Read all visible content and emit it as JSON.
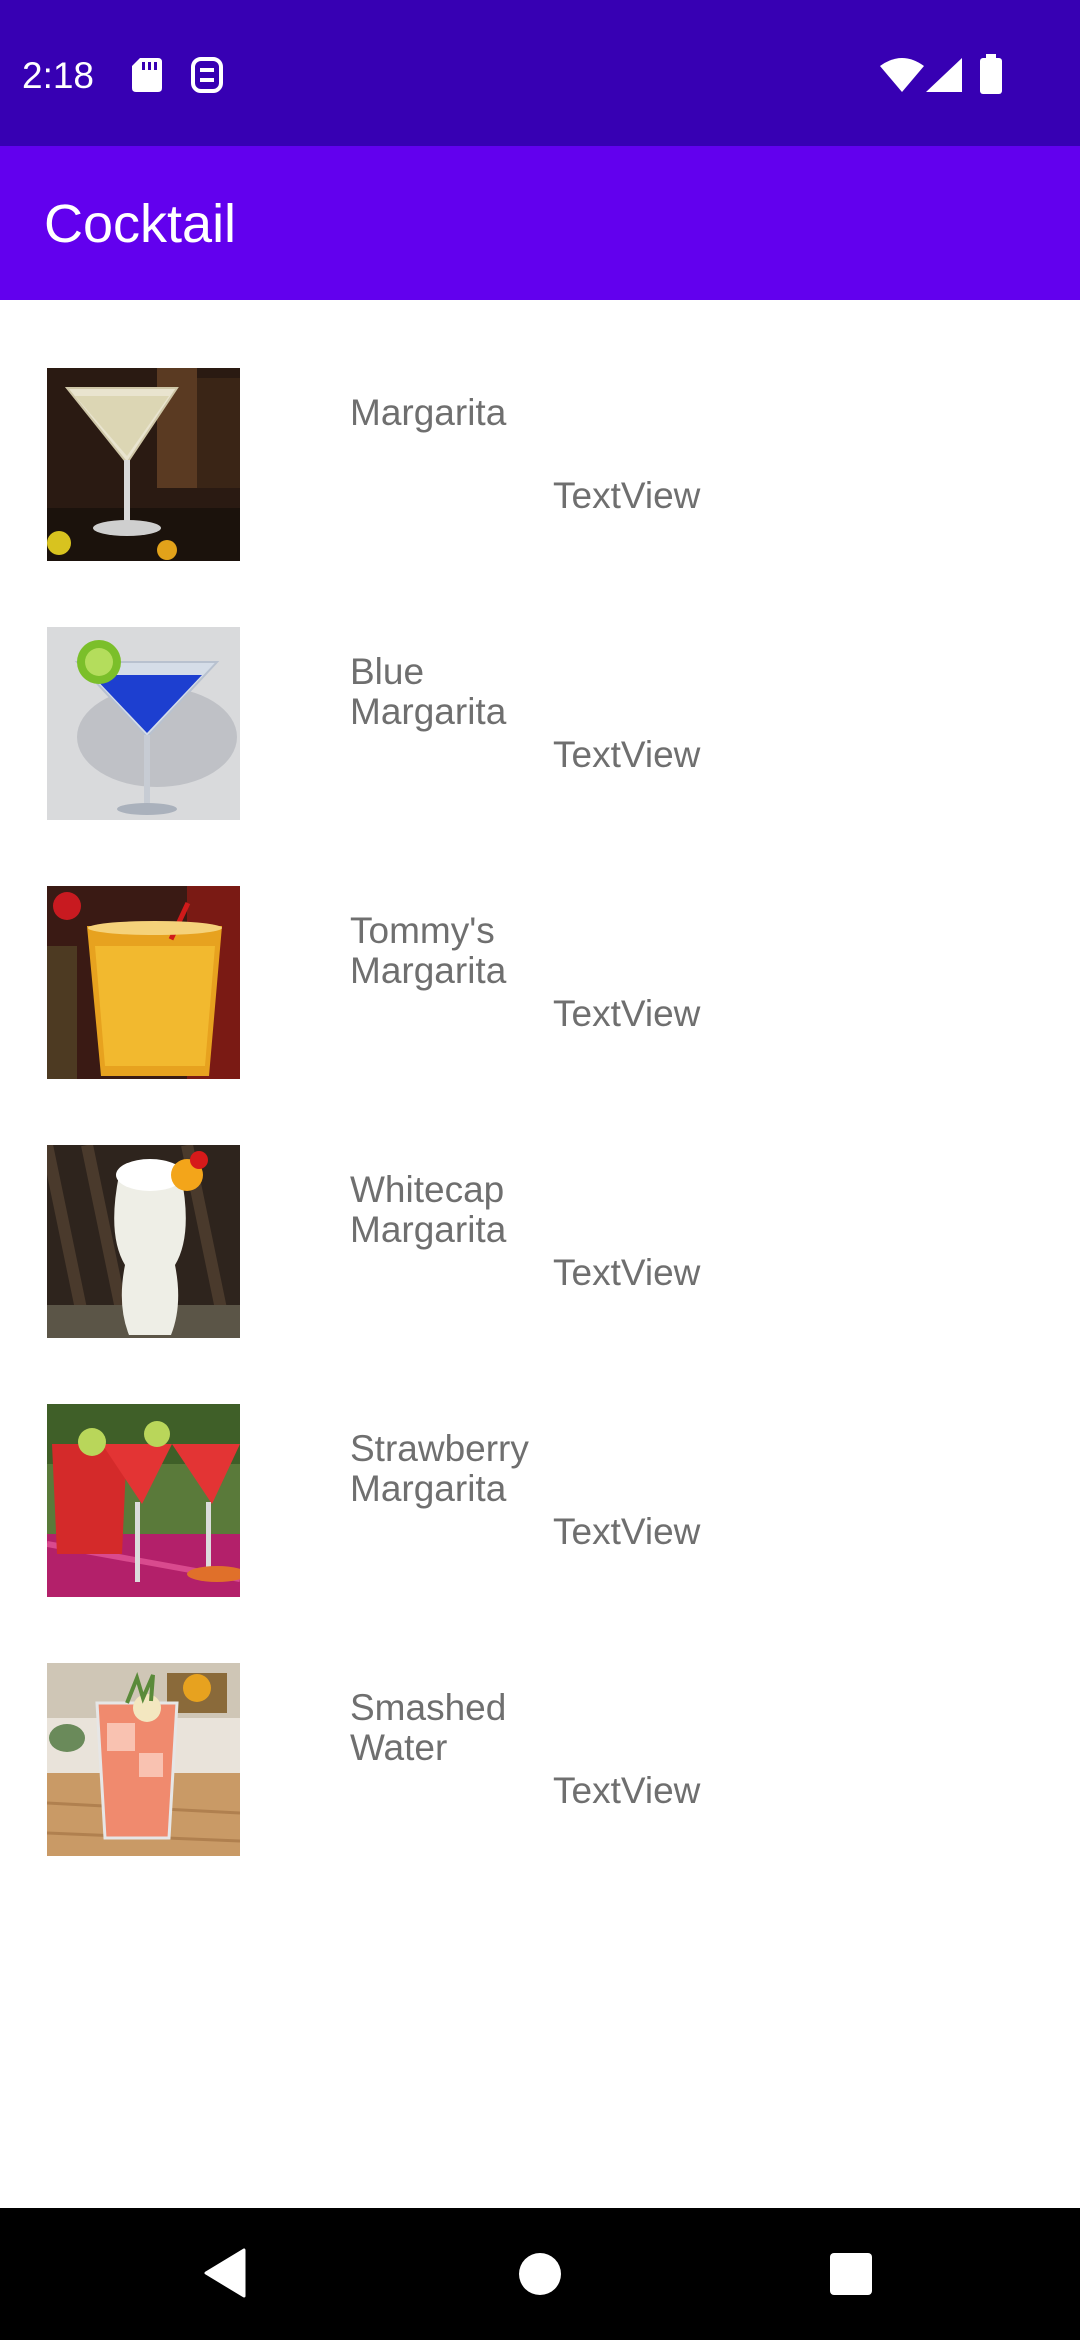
{
  "status_bar": {
    "time": "2:18",
    "icons": [
      "sd-card-icon",
      "sync-icon",
      "wifi-icon",
      "signal-icon",
      "battery-icon"
    ],
    "background": "#3700b3"
  },
  "app_bar": {
    "title": "Cocktail",
    "background": "#6200ee"
  },
  "cocktails": [
    {
      "name": "Margarita",
      "description": "TextView",
      "image": "margarita-photo"
    },
    {
      "name": "Blue Margarita",
      "description": "TextView",
      "image": "blue-margarita-photo"
    },
    {
      "name": "Tommy's Margarita",
      "description": "TextView",
      "image": "tommys-margarita-photo"
    },
    {
      "name": "Whitecap Margarita",
      "description": "TextView",
      "image": "whitecap-margarita-photo"
    },
    {
      "name": "Strawberry Margarita",
      "description": "TextView",
      "image": "strawberry-margarita-photo"
    },
    {
      "name": "Smashed Water",
      "description": "TextView",
      "image": "smashed-water-photo"
    }
  ],
  "nav_bar": {
    "buttons": [
      "back-icon",
      "home-icon",
      "recents-icon"
    ]
  }
}
